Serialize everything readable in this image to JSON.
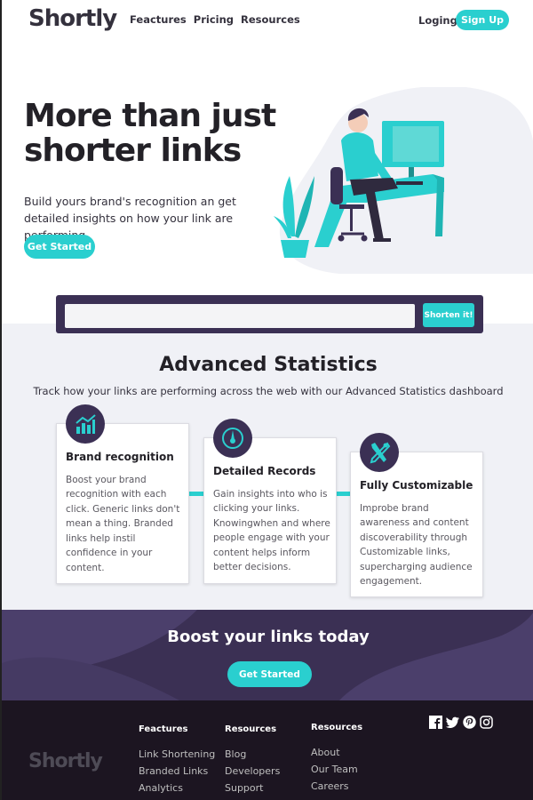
{
  "nav": {
    "logo": "Shortly",
    "links": [
      "Feactures",
      "Pricing",
      "Resources"
    ],
    "login": "Loging",
    "signup": "Sign Up"
  },
  "hero": {
    "title": "More than just shorter links",
    "subtitle": "Build yours brand's recognition an get detailed insights on how your link are performing",
    "cta": "Get Started"
  },
  "shorten": {
    "placeholder": "",
    "button": "Shorten it!"
  },
  "stats": {
    "title": "Advanced Statistics",
    "subtitle": "Track how your links are performing across the web with our Advanced Statistics dashboard",
    "cards": [
      {
        "icon": "chart-icon",
        "title": "Brand recognition",
        "body": "Boost your brand recognition with each click. Generic links don't mean a thing. Branded links help instil confidence in your content."
      },
      {
        "icon": "gauge-icon",
        "title": "Detailed Records",
        "body": "Gain insights into who is clicking your links. Knowingwhen and where people engage with your content helps inform better decisions."
      },
      {
        "icon": "tools-icon",
        "title": "Fully Customizable",
        "body": "Improbe brand awareness and content discoverability through Customizable links, supercharging audience engagement."
      }
    ]
  },
  "boost": {
    "title": "Boost your links today",
    "cta": "Get Started"
  },
  "footer": {
    "logo": "Shortly",
    "columns": [
      {
        "title": "Feactures",
        "items": [
          "Link Shortening",
          "Branded Links",
          "Analytics"
        ]
      },
      {
        "title": "Resources",
        "items": [
          "Blog",
          "Developers",
          "Support"
        ]
      },
      {
        "title": "Resources",
        "items": [
          "About",
          "Our Team",
          "Careers"
        ]
      }
    ],
    "socials": [
      "facebook-icon",
      "twitter-icon",
      "pinterest-icon",
      "instagram-icon"
    ]
  },
  "colors": {
    "accent": "#2acfcf",
    "dark_violet": "#3b3054",
    "footer_bg": "#1c1521",
    "section_bg": "#f0f1f6"
  }
}
